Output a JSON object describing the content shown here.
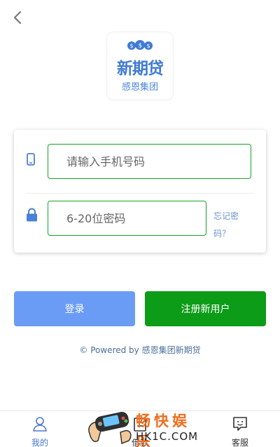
{
  "header": {
    "back_icon": "chevron-left-icon"
  },
  "logo": {
    "icon": "money-bag-icon",
    "main_text": "新期贷",
    "sub_text": "感恩集团"
  },
  "login_form": {
    "phone_placeholder": "请输入手机号码",
    "password_placeholder": "6-20位密码",
    "forgot_label": "忘记密码？"
  },
  "buttons": {
    "login_label": "登录",
    "register_label": "注册新用户"
  },
  "footer": {
    "powered_text": "© Powered by 感恩集团新期贷"
  },
  "tabbar": {
    "items": [
      {
        "label": "我的",
        "icon": "user-icon",
        "active": true
      },
      {
        "label": "借款",
        "icon": "loan-icon",
        "active": false
      },
      {
        "label": "客服",
        "icon": "chat-icon",
        "active": false
      }
    ]
  },
  "watermark": {
    "line1": "畅快娱乐",
    "line2": "HK1C.COM"
  },
  "colors": {
    "accent_blue": "#6b9cf5",
    "primary_green": "#0c9c18",
    "input_border": "#18a227",
    "icon_blue": "#4a80d6"
  }
}
